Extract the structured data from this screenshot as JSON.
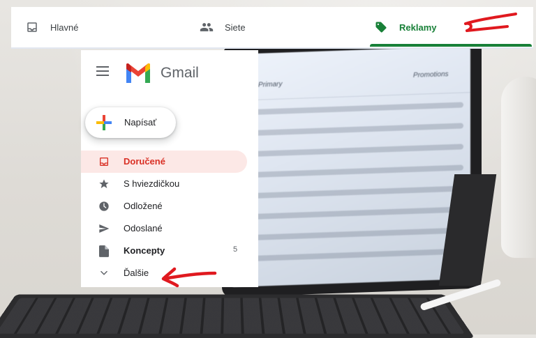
{
  "tabs": {
    "primary": {
      "label": "Hlavné",
      "icon": "inbox-icon"
    },
    "social": {
      "label": "Siete",
      "icon": "people-icon"
    },
    "promotions": {
      "label": "Reklamy",
      "icon": "tag-icon",
      "color": "#188038"
    }
  },
  "sidebar": {
    "app_name": "Gmail",
    "compose_label": "Napísať",
    "items": [
      {
        "label": "Doručené",
        "icon": "inbox-icon",
        "active": true
      },
      {
        "label": "S hviezdičkou",
        "icon": "star-icon"
      },
      {
        "label": "Odložené",
        "icon": "clock-icon"
      },
      {
        "label": "Odoslané",
        "icon": "send-icon"
      },
      {
        "label": "Koncepty",
        "icon": "draft-icon",
        "count": "5",
        "bold": true
      },
      {
        "label": "Ďalšie",
        "icon": "chevron-down-icon"
      }
    ]
  },
  "colors": {
    "active_text": "#d93025",
    "active_bg": "#fce8e6",
    "promo_green": "#188038",
    "annotation_red": "#e0191f"
  },
  "tablet_screen": {
    "tab_primary": "Primary",
    "tab_promotions": "Promotions"
  }
}
